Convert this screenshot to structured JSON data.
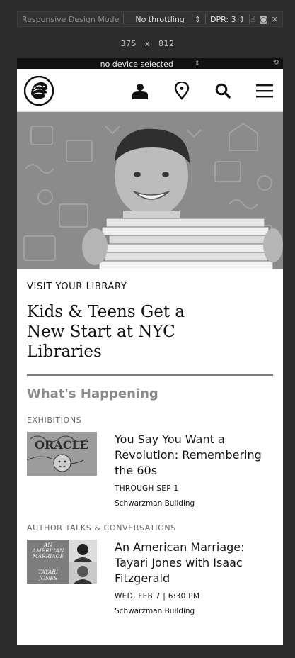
{
  "devtools": {
    "mode_label": "Responsive Design Mode",
    "throttle_label": "No throttling",
    "throttle_arrows": "⇕",
    "dpr_label": "DPR: 3 ⇕",
    "width": "375",
    "times": "x",
    "height": "812",
    "device_label": "no device selected",
    "device_arrows": "⇕"
  },
  "header": {
    "icons": [
      "lion-logo-icon",
      "user-icon",
      "location-pin-icon",
      "search-icon",
      "menu-icon"
    ]
  },
  "feature": {
    "kicker": "VISIT YOUR LIBRARY",
    "headline": "Kids & Teens Get a New Start at NYC Libraries"
  },
  "whats_happening": {
    "title": "What's Happening",
    "events": [
      {
        "category": "EXHIBITIONS",
        "title": "You Say You Want a Revolution: Remembering the 60s",
        "date": "THROUGH SEP 1",
        "location": "Schwarzman Building"
      },
      {
        "category": "AUTHOR TALKS & CONVERSATIONS",
        "title": "An American Marriage: Tayari Jones with Isaac Fitzgerald",
        "date": "WED, FEB 7 | 6:30 PM",
        "location": "Schwarzman Building"
      }
    ]
  },
  "thumb_text": {
    "oracle": "ORACLE",
    "book_title_1": "AN",
    "book_title_2": "AMERICAN",
    "book_title_3": "MARRIAGE",
    "book_author_1": "TAYARI",
    "book_author_2": "JONES"
  }
}
